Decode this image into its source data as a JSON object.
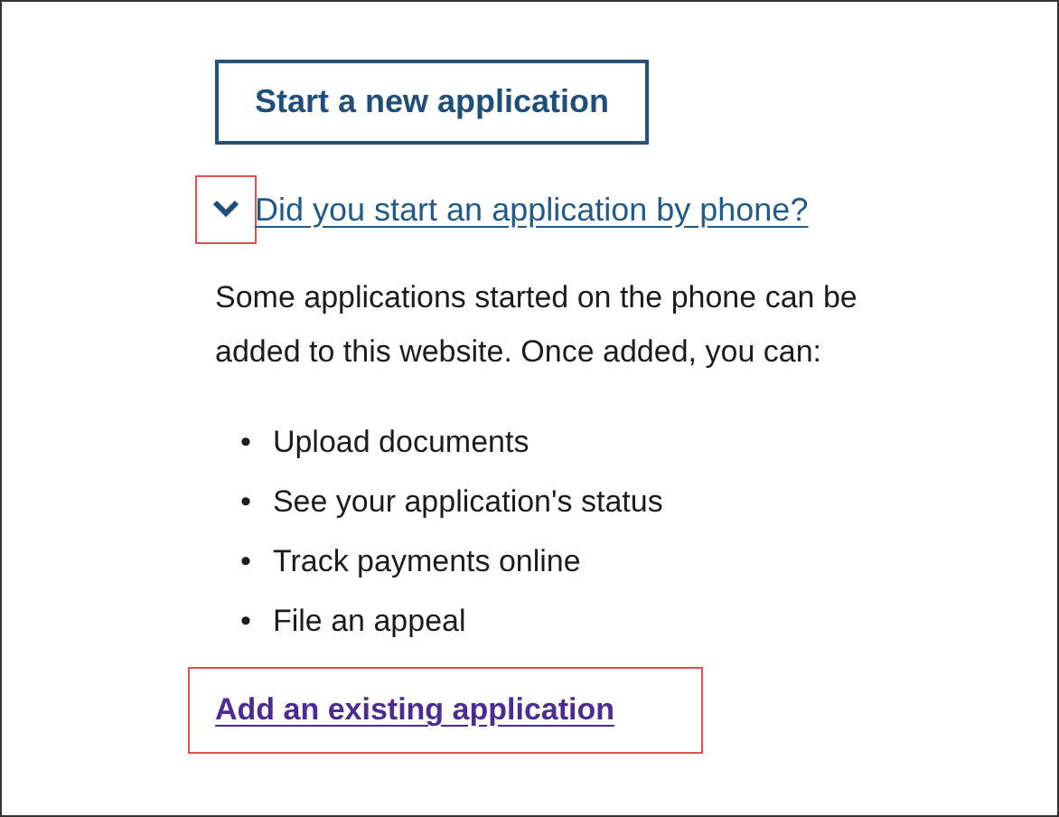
{
  "start_button": {
    "label": "Start a new application"
  },
  "disclosure": {
    "label": "Did you start an application by phone?",
    "expanded": true,
    "highlighted": true,
    "intro": "Some applications started on the phone can be added to this website. Once added, you can:",
    "items": [
      {
        "marker": "•",
        "text": "Upload documents"
      },
      {
        "marker": "•",
        "text": "See your application's status"
      },
      {
        "marker": "•",
        "text": "Track payments online"
      },
      {
        "marker": "•",
        "text": "File an appeal"
      }
    ],
    "link": {
      "label": "Add an existing application",
      "highlighted": true
    }
  }
}
